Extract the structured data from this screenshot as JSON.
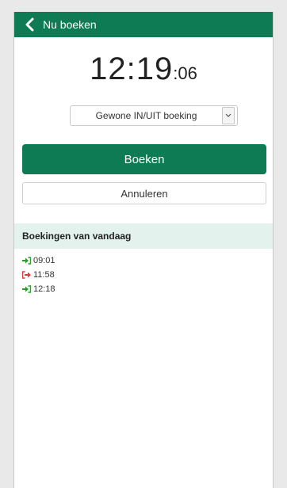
{
  "header": {
    "title": "Nu boeken"
  },
  "clock": {
    "hours_minutes": "12:19",
    "seconds": ":06"
  },
  "booking_type": {
    "selected": "Gewone IN/UIT boeking"
  },
  "actions": {
    "book_label": "Boeken",
    "cancel_label": "Annuleren"
  },
  "today": {
    "heading": "Boekingen van vandaag",
    "items": [
      {
        "time": "09:01",
        "kind": "in",
        "icon": "sign-in-icon",
        "color": "#2e9b2e"
      },
      {
        "time": "11:58",
        "kind": "out",
        "icon": "sign-out-icon",
        "color": "#e53935"
      },
      {
        "time": "12:18",
        "kind": "in",
        "icon": "sign-in-icon",
        "color": "#2e9b2e"
      }
    ]
  },
  "colors": {
    "brand": "#0f7b55",
    "section_bg": "#e3f2ec"
  }
}
